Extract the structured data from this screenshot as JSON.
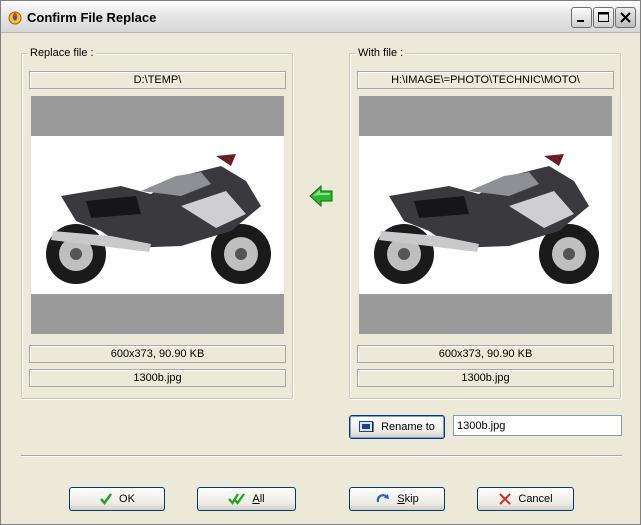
{
  "window": {
    "title": "Confirm File Replace"
  },
  "replace_panel": {
    "legend": "Replace file :",
    "path": "D:\\TEMP\\",
    "info": "600x373, 90.90 KB",
    "filename": "1300b.jpg"
  },
  "with_panel": {
    "legend": "With file :",
    "path": "H:\\IMAGE\\=PHOTO\\TECHNIC\\MOTO\\",
    "info": "600x373, 90.90 KB",
    "filename": "1300b.jpg"
  },
  "rename": {
    "button_label": "Rename to",
    "input_value": "1300b.jpg"
  },
  "buttons": {
    "ok": {
      "pre": "",
      "underlined": "",
      "post": "OK"
    },
    "all": {
      "pre": "",
      "underlined": "A",
      "post": "ll"
    },
    "skip": {
      "pre": "",
      "underlined": "S",
      "post": "kip"
    },
    "cancel": {
      "pre": "",
      "underlined": "",
      "post": "Cancel"
    }
  },
  "colors": {
    "arrow": "#2fb52f",
    "ok_check": "#22a422",
    "skip_icon": "#2a5bd7",
    "cancel_x": "#d92b1e",
    "preview_band": "#9a9a9a",
    "dialog_face": "#ece9d8"
  },
  "icons": {
    "app": "app-flame-icon",
    "arrow": "left-arrow-icon",
    "rename": "rename-icon",
    "ok": "check-icon",
    "all": "double-check-icon",
    "skip": "skip-arrow-icon",
    "cancel": "x-icon"
  }
}
